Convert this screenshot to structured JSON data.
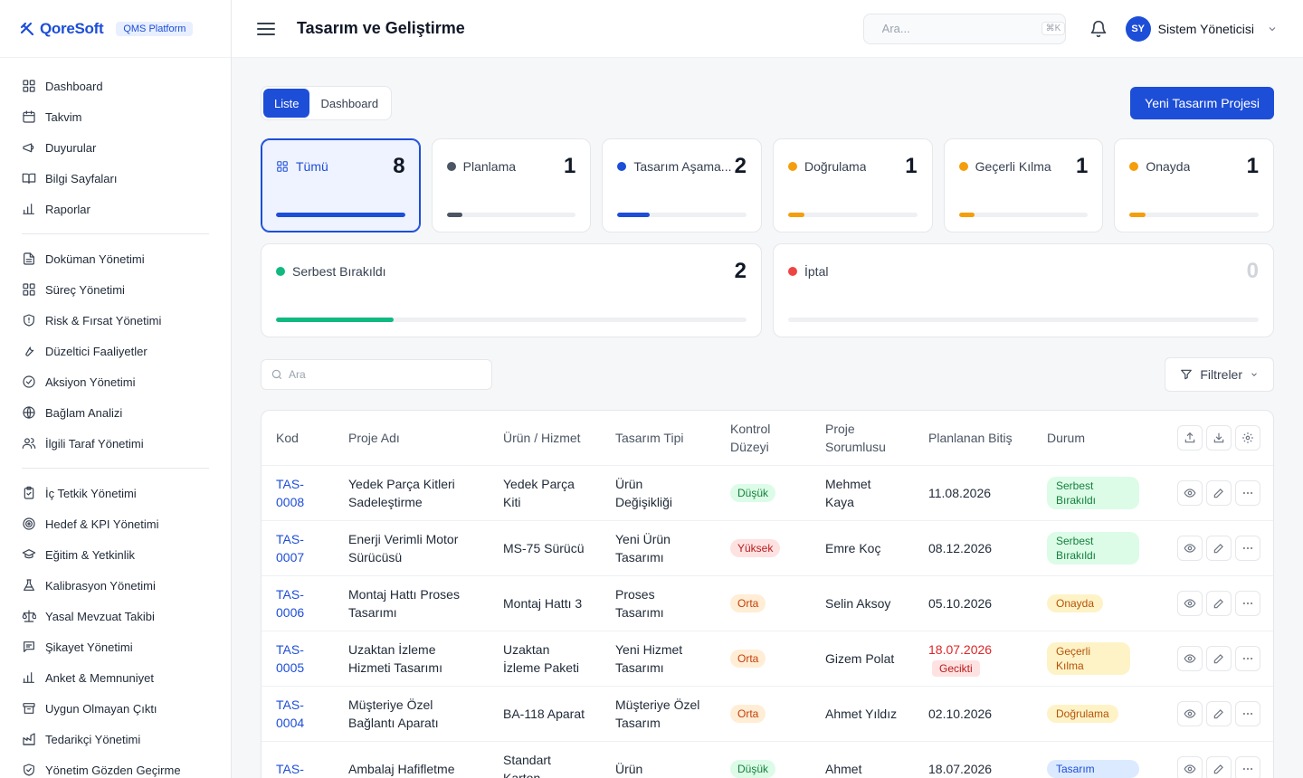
{
  "brand": {
    "name": "QoreSoft",
    "badge": "QMS Platform"
  },
  "sidebar": {
    "groups": [
      [
        {
          "label": "Dashboard",
          "icon": "grid-icon"
        },
        {
          "label": "Takvim",
          "icon": "calendar-icon"
        },
        {
          "label": "Duyurular",
          "icon": "megaphone-icon"
        },
        {
          "label": "Bilgi Sayfaları",
          "icon": "book-icon"
        },
        {
          "label": "Raporlar",
          "icon": "bar-chart-icon"
        }
      ],
      [
        {
          "label": "Doküman Yönetimi",
          "icon": "document-icon"
        },
        {
          "label": "Süreç Yönetimi",
          "icon": "grid-icon"
        },
        {
          "label": "Risk & Fırsat Yönetimi",
          "icon": "shield-icon"
        },
        {
          "label": "Düzeltici Faaliyetler",
          "icon": "wrench-icon"
        },
        {
          "label": "Aksiyon Yönetimi",
          "icon": "check-circle-icon"
        },
        {
          "label": "Bağlam Analizi",
          "icon": "globe-icon"
        },
        {
          "label": "İlgili Taraf Yönetimi",
          "icon": "users-icon"
        }
      ],
      [
        {
          "label": "İç Tetkik Yönetimi",
          "icon": "clipboard-icon"
        },
        {
          "label": "Hedef & KPI Yönetimi",
          "icon": "target-icon"
        },
        {
          "label": "Eğitim & Yetkinlik",
          "icon": "graduation-cap-icon"
        },
        {
          "label": "Kalibrasyon Yönetimi",
          "icon": "flask-icon"
        },
        {
          "label": "Yasal Mevzuat Takibi",
          "icon": "scale-icon"
        },
        {
          "label": "Şikayet Yönetimi",
          "icon": "message-icon"
        },
        {
          "label": "Anket & Memnuniyet",
          "icon": "bar-chart-icon"
        },
        {
          "label": "Uygun Olmayan Çıktı",
          "icon": "archive-icon"
        },
        {
          "label": "Tedarikçi Yönetimi",
          "icon": "factory-icon"
        },
        {
          "label": "Yönetim Gözden Geçirme",
          "icon": "shield-check-icon"
        }
      ]
    ]
  },
  "header": {
    "title": "Tasarım ve Geliştirme",
    "search_placeholder": "Ara...",
    "search_shortcut": "⌘K",
    "user_initials": "SY",
    "user_name": "Sistem Yöneticisi"
  },
  "main": {
    "tabs": [
      {
        "label": "Liste",
        "active": true
      },
      {
        "label": "Dashboard",
        "active": false
      }
    ],
    "new_button": "Yeni Tasarım Projesi",
    "summary_cards": [
      {
        "label": "Tümü",
        "count": "8",
        "color": "#1d4ed8",
        "fill": 1.0,
        "active": true,
        "icon": "grid-icon"
      },
      {
        "label": "Planlama",
        "count": "1",
        "color": "#4b5563",
        "fill": 0.125
      },
      {
        "label": "Tasarım Aşama...",
        "count": "2",
        "color": "#1d4ed8",
        "fill": 0.25
      },
      {
        "label": "Doğrulama",
        "count": "1",
        "color": "#f59e0b",
        "fill": 0.125
      },
      {
        "label": "Geçerli Kılma",
        "count": "1",
        "color": "#f59e0b",
        "fill": 0.125
      },
      {
        "label": "Onayda",
        "count": "1",
        "color": "#f59e0b",
        "fill": 0.125
      }
    ],
    "summary_cards_row2": [
      {
        "label": "Serbest Bırakıldı",
        "count": "2",
        "color": "#10b981",
        "fill": 0.25
      },
      {
        "label": "İptal",
        "count": "0",
        "color": "#ef4444",
        "fill": 0
      }
    ],
    "table_search_placeholder": "Ara",
    "filter_label": "Filtreler",
    "table": {
      "columns": [
        "Kod",
        "Proje Adı",
        "Ürün / Hizmet",
        "Tasarım Tipi",
        "Kontrol Düzeyi",
        "Proje Sorumlusu",
        "Planlanan Bitiş",
        "Durum"
      ],
      "rows": [
        {
          "code": "TAS-0008",
          "name": "Yedek Parça Kitleri Sadeleştirme",
          "product": "Yedek Parça Kiti",
          "type": "Ürün Değişikliği",
          "control": "Düşük",
          "control_level": "low",
          "owner": "Mehmet Kaya",
          "due": "11.08.2026",
          "late": "",
          "status": "Serbest Bırakıldı",
          "status_kind": "released"
        },
        {
          "code": "TAS-0007",
          "name": "Enerji Verimli Motor Sürücüsü",
          "product": "MS-75 Sürücü",
          "type": "Yeni Ürün Tasarımı",
          "control": "Yüksek",
          "control_level": "high",
          "owner": "Emre Koç",
          "due": "08.12.2026",
          "late": "",
          "status": "Serbest Bırakıldı",
          "status_kind": "released"
        },
        {
          "code": "TAS-0006",
          "name": "Montaj Hattı Proses Tasarımı",
          "product": "Montaj Hattı 3",
          "type": "Proses Tasarımı",
          "control": "Orta",
          "control_level": "mid",
          "owner": "Selin Aksoy",
          "due": "05.10.2026",
          "late": "",
          "status": "Onayda",
          "status_kind": "approve"
        },
        {
          "code": "TAS-0005",
          "name": "Uzaktan İzleme Hizmeti Tasarımı",
          "product": "Uzaktan İzleme Paketi",
          "type": "Yeni Hizmet Tasarımı",
          "control": "Orta",
          "control_level": "mid",
          "owner": "Gizem Polat",
          "due": "18.07.2026",
          "late": "Gecikti",
          "status": "Geçerli Kılma",
          "status_kind": "valid"
        },
        {
          "code": "TAS-0004",
          "name": "Müşteriye Özel Bağlantı Aparatı",
          "product": "BA-118 Aparat",
          "type": "Müşteriye Özel Tasarım",
          "control": "Orta",
          "control_level": "mid",
          "owner": "Ahmet Yıldız",
          "due": "02.10.2026",
          "late": "",
          "status": "Doğrulama",
          "status_kind": "verify"
        },
        {
          "code": "TAS-",
          "name": "Ambalaj Hafifletme",
          "product": "Standart Karton",
          "type": "Ürün",
          "control": "Düşük",
          "control_level": "low",
          "owner": "Ahmet",
          "due": "18.07.2026",
          "late": "",
          "status": "Tasarım",
          "status_kind": "design"
        }
      ]
    }
  }
}
